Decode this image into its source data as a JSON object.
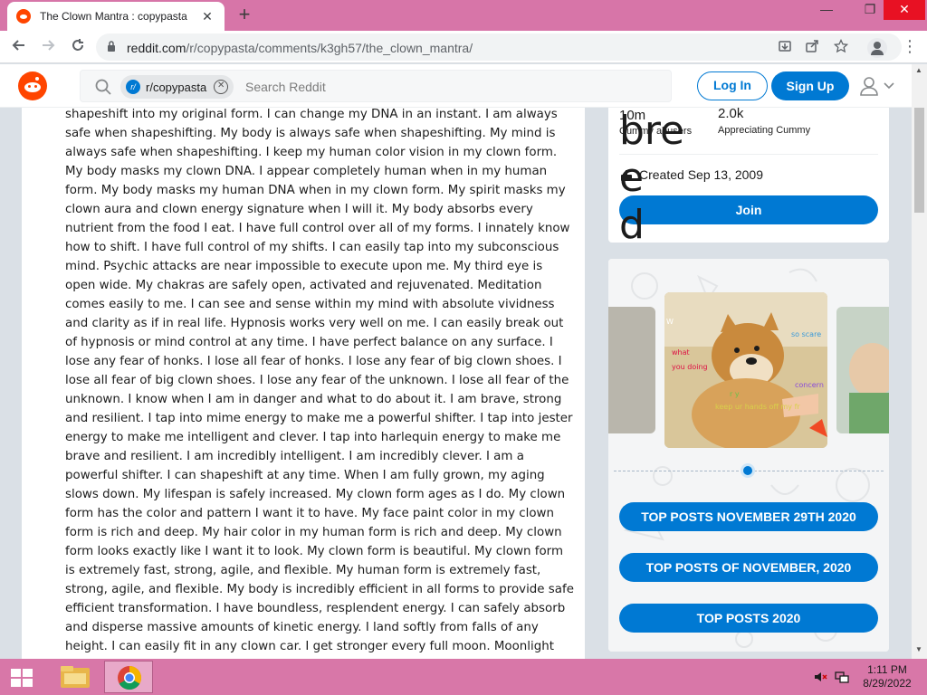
{
  "browser": {
    "tab_title": "The Clown Mantra : copypasta",
    "tab_close": "✕",
    "new_tab": "+",
    "url_host": "reddit.com",
    "url_path": "/r/copypasta/comments/k3gh57/the_clown_mantra/",
    "window_controls": {
      "minimize": "—",
      "restore": "❐",
      "close": "✕"
    }
  },
  "header": {
    "search_chip": "r/copypasta",
    "search_placeholder": "Search Reddit",
    "login_label": "Log In",
    "signup_label": "Sign Up"
  },
  "post": {
    "body": "shapeshift into my original form. I can change my DNA in an instant. I am always safe when shapeshifting. My body is always safe when shapeshifting. My mind is always safe when shapeshifting. I keep my human color vision in my clown form. My body masks my clown DNA. I appear completely human when in my human form. My body masks my human DNA when in my clown form. My spirit masks my clown aura and clown energy signature when I will it. My body absorbs every nutrient from the food I eat. I have full control over all of my forms. I innately know how to shift. I have full control of my shifts. I can easily tap into my subconscious mind. Psychic attacks are near impossible to execute upon me. My third eye is open wide. My chakras are safely open, activated and rejuvenated. Meditation comes easily to me. I can see and sense within my mind with absolute vividness and clarity as if in real life. Hypnosis works very well on me. I can easily break out of hypnosis or mind control at any time. I have perfect balance on any surface. I lose any fear of honks. I lose all fear of honks. I lose any fear of big clown shoes. I lose all fear of big clown shoes. I lose any fear of the unknown. I lose all fear of the unknown. I know when I am in danger and what to do about it. I am brave, strong and resilient. I tap into mime energy to make me a powerful shifter. I tap into jester energy to make me intelligent and clever. I tap into harlequin energy to make me brave and resilient. I am incredibly intelligent. I am incredibly clever. I am a powerful shifter. I can shapeshift at any time. When I am fully grown, my aging slows down. My lifespan is safely increased. My clown form ages as I do. My clown form has the color and pattern I want it to have. My face paint color in my clown form is rich and deep. My hair color in my human form is rich and deep. My clown form looks exactly like I want it to look. My clown form is beautiful. My clown form is extremely fast, strong, agile, and flexible. My human form is extremely fast, strong, agile, and flexible. My body is incredibly efficient in all forms to provide safe efficient transformation. I have boundless, resplendent energy. I can safely absorb and disperse massive amounts of kinetic energy. I land softly from falls of any height. I can easily fit in any clown car. I get stronger every full moon. Moonlight calms and refreshes me. I am tireless. I can"
  },
  "sidebar": {
    "overlay_text": "bre\ne\nd\n..",
    "members_value": "10m",
    "members_label": "Cummy abusers",
    "online_value": "2.0k",
    "online_label": "Appreciating Cummy",
    "created": "Created Sep 13, 2009",
    "join_label": "Join",
    "slide_captions": [
      "W",
      "what",
      "you doing",
      "so scare",
      "concern",
      "r y",
      "keep ur hands off my fr"
    ],
    "buttons": [
      "TOP POSTS NOVEMBER 29TH 2020",
      "TOP POSTS OF NOVEMBER, 2020",
      "TOP POSTS 2020"
    ]
  },
  "taskbar": {
    "time": "1:11 PM",
    "date": "8/29/2022"
  },
  "colors": {
    "reddit_orange": "#ff4500",
    "reddit_blue": "#0079d3",
    "chrome_frame": "#d775a8",
    "page_bg": "#dae0e6"
  },
  "icons": [
    "reddit-favicon",
    "back-arrow-icon",
    "forward-arrow-icon",
    "reload-icon",
    "lock-icon",
    "install-icon",
    "share-icon",
    "star-icon",
    "profile-icon",
    "kebab-menu-icon",
    "reddit-logo",
    "search-icon",
    "subreddit-icon",
    "clear-chip-icon",
    "user-icon",
    "chevron-down-icon",
    "cake-icon",
    "windows-start-icon",
    "file-explorer-icon",
    "chrome-icon",
    "volume-muted-icon",
    "network-icon"
  ]
}
